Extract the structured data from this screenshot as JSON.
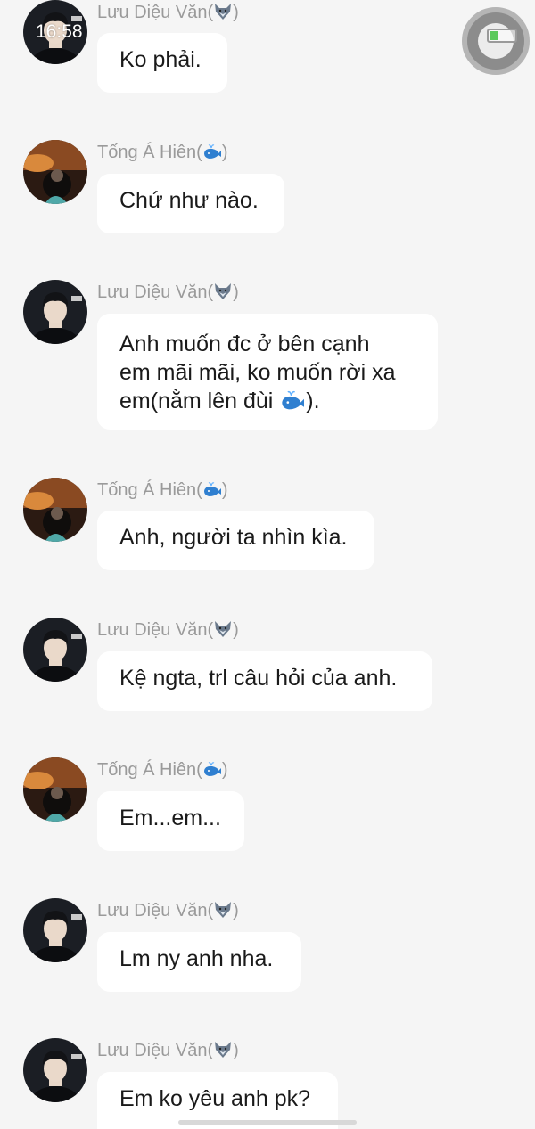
{
  "status": {
    "time": "16:58",
    "battery_level": 0.35
  },
  "messages": [
    {
      "sender": "Lưu Diệu Văn(",
      "tail": ")",
      "emoji": "wolf-emoji",
      "avatar": "avatar-dv",
      "text": "Ko phải."
    },
    {
      "sender": "Tống Á Hiên(",
      "tail": ")",
      "emoji": "whale-emoji",
      "avatar": "avatar-ah",
      "text": "Chứ như nào."
    },
    {
      "sender": "Lưu Diệu Văn(",
      "tail": ")",
      "emoji": "wolf-emoji",
      "avatar": "avatar-dv",
      "text_lines": [
        "Anh muốn đc ở bên cạnh",
        "em mãi mãi, ko muốn rời xa",
        "em(nằm lên đùi ",
        ")."
      ],
      "inline_emoji": "whale-emoji"
    },
    {
      "sender": "Tống Á Hiên(",
      "tail": ")",
      "emoji": "whale-emoji",
      "avatar": "avatar-ah",
      "text": "Anh, người ta nhìn kìa."
    },
    {
      "sender": "Lưu Diệu Văn(",
      "tail": ")",
      "emoji": "wolf-emoji",
      "avatar": "avatar-dv",
      "text": "Kệ ngta, trl câu hỏi của anh."
    },
    {
      "sender": "Tống Á Hiên(",
      "tail": ")",
      "emoji": "whale-emoji",
      "avatar": "avatar-ah",
      "text": "Em...em..."
    },
    {
      "sender": "Lưu Diệu Văn(",
      "tail": ")",
      "emoji": "wolf-emoji",
      "avatar": "avatar-dv",
      "text": "Lm ny anh nha."
    },
    {
      "sender": "Lưu Diệu Văn(",
      "tail": ")",
      "emoji": "wolf-emoji",
      "avatar": "avatar-dv",
      "text": "Em ko yêu anh pk?"
    }
  ],
  "colors": {
    "background": "#f5f5f5",
    "bubble": "#ffffff",
    "name": "#9a9a9a",
    "text": "#1a1a1a"
  }
}
